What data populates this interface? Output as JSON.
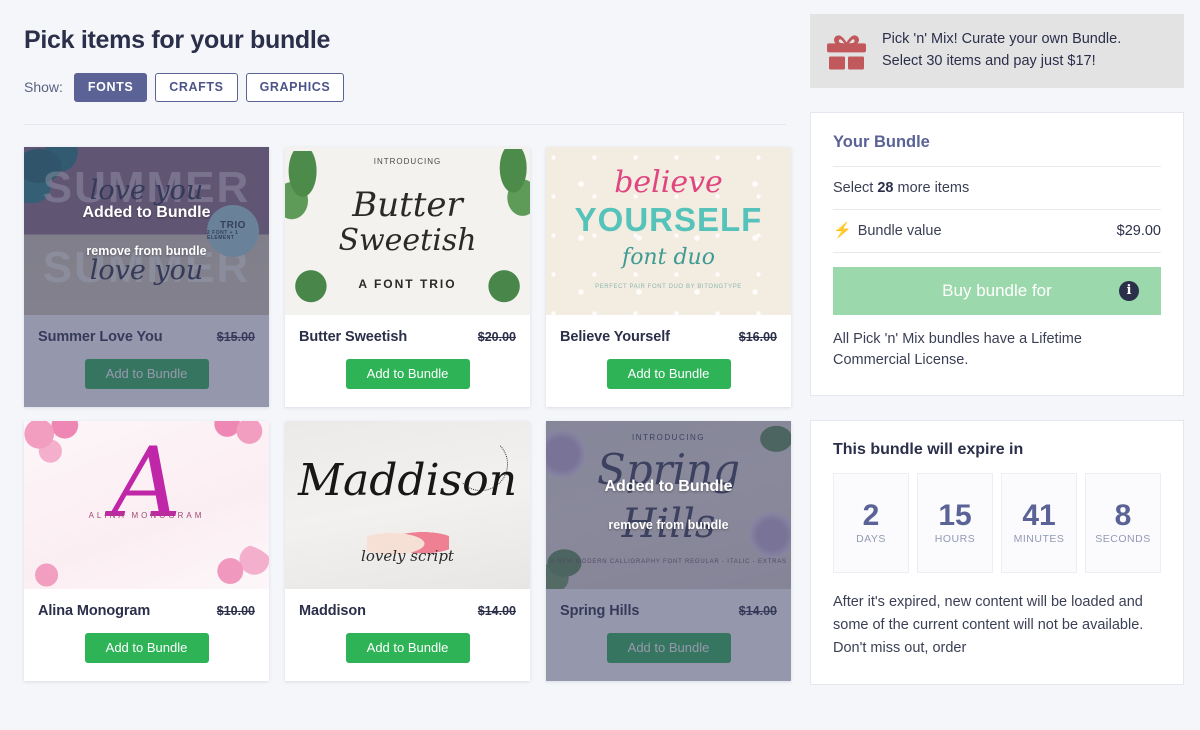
{
  "header": {
    "title": "Pick items for your bundle",
    "show_label": "Show:",
    "filters": [
      {
        "label": "FONTS",
        "active": true
      },
      {
        "label": "CRAFTS",
        "active": false
      },
      {
        "label": "GRAPHICS",
        "active": false
      }
    ]
  },
  "promo": {
    "icon": "gift-icon",
    "line1": "Pick 'n' Mix! Curate your own Bundle.",
    "line2": "Select 30 items and pay just $17!"
  },
  "products": [
    {
      "title": "Summer Love You",
      "price": "$15.00",
      "button": "Add to Bundle",
      "added": true,
      "added_label": "Added to Bundle",
      "remove_label": "remove from bundle",
      "art": {
        "big1": "SUMMER",
        "big2": "SUMMER",
        "script1": "love you",
        "script2": "love you",
        "badge": "TRIO",
        "badge_sub": "2 FONT + 1 ELEMENT"
      }
    },
    {
      "title": "Butter Sweetish",
      "price": "$20.00",
      "button": "Add to Bundle",
      "added": false,
      "art": {
        "banner": "INTRODUCING",
        "word1": "Butter",
        "word2": "Sweetish",
        "word3": "A FONT TRIO"
      }
    },
    {
      "title": "Believe Yourself",
      "price": "$16.00",
      "button": "Add to Bundle",
      "added": false,
      "art": {
        "line1": "believe",
        "line2": "YOURSELF",
        "line3": "font  duo",
        "line4": "PERFECT PAIR FONT DUO BY BITONGTYPE"
      }
    },
    {
      "title": "Alina Monogram",
      "price": "$10.00",
      "button": "Add to Bundle",
      "added": false,
      "art": {
        "mono": "A",
        "caption": "ALINA MONOGRAM"
      }
    },
    {
      "title": "Maddison",
      "price": "$14.00",
      "button": "Add to Bundle",
      "added": false,
      "art": {
        "word": "Maddison",
        "sub": "lovely script"
      }
    },
    {
      "title": "Spring Hills",
      "price": "$14.00",
      "button": "Add to Bundle",
      "added": true,
      "added_label": "Added to Bundle",
      "remove_label": "remove from bundle",
      "art": {
        "intro": "INTRODUCING",
        "word1": "Spring",
        "word2": "Hills",
        "sub": "A NEW MODERN CALLIGRAPHY FONT REGULAR - ITALIC - EXTRAS"
      }
    }
  ],
  "bundle": {
    "title": "Your Bundle",
    "select_prefix": "Select ",
    "select_count": "28",
    "select_suffix": " more items",
    "value_icon": "lightning-bolt-icon",
    "value_label": "Bundle value",
    "value_amount": "$29.00",
    "buy_label": "Buy bundle for",
    "info_icon": "info-icon",
    "license": "All Pick 'n' Mix bundles have a Lifetime Commercial License."
  },
  "expiry": {
    "title": "This bundle will expire in",
    "units": [
      {
        "value": "2",
        "label": "DAYS"
      },
      {
        "value": "15",
        "label": "HOURS"
      },
      {
        "value": "41",
        "label": "MINUTES"
      },
      {
        "value": "8",
        "label": "SECONDS"
      }
    ],
    "note": "After it's expired, new content will be loaded and some of the current content will not be available. Don't miss out, order"
  },
  "colors": {
    "accent_indigo": "#5a6296",
    "green": "#2eb357",
    "buy_green": "#9bd8ab",
    "promo_red": "#c0585c",
    "bolt_yellow": "#f5c518",
    "page_bg": "#f4f6fa"
  }
}
